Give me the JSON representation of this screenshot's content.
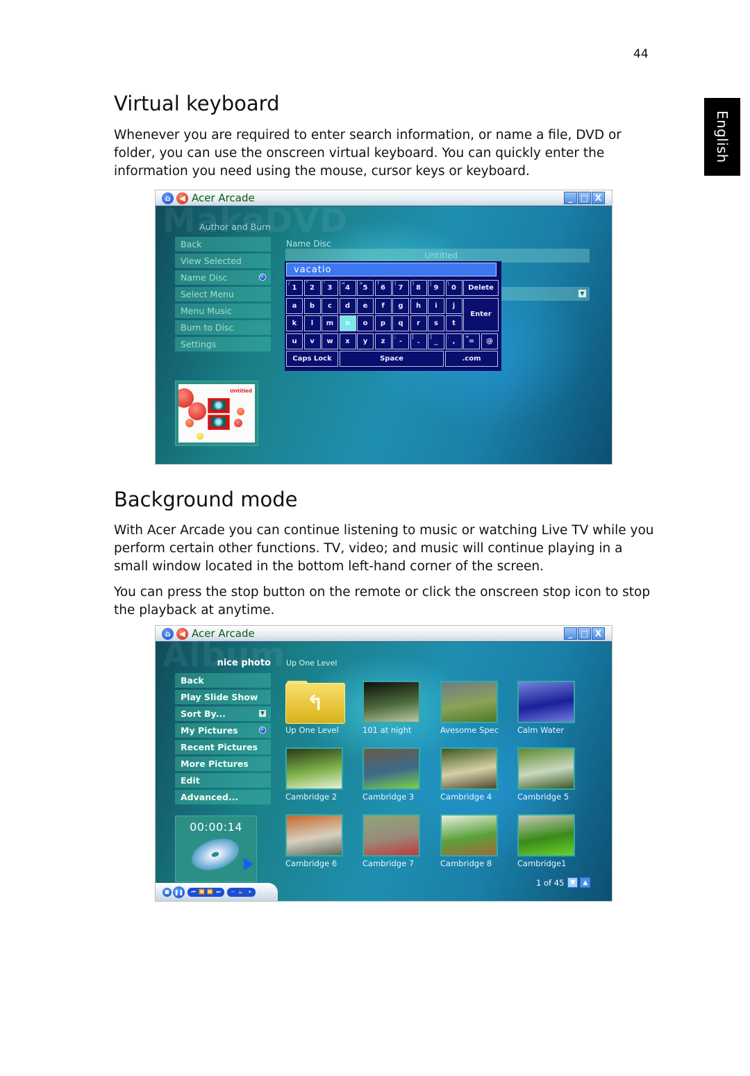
{
  "page": {
    "number": "44",
    "language_tab": "English"
  },
  "sections": [
    {
      "heading": "Virtual keyboard",
      "paragraphs": [
        "Whenever you are required to enter search information, or name a file, DVD or folder, you can use the onscreen virtual keyboard. You can quickly enter the information you need using the mouse, cursor keys or keyboard."
      ]
    },
    {
      "heading": "Background mode",
      "paragraphs": [
        "With Acer Arcade you can continue listening to music or watching Live TV while you perform certain other functions. TV, video; and music will continue playing in a small window located in the bottom left-hand corner of the screen.",
        "You can press the stop button on the remote or click the onscreen stop icon to stop the playback at anytime."
      ]
    }
  ],
  "screenshot1": {
    "app_title": "Acer Arcade",
    "window_controls": {
      "minimize": "_",
      "maximize": "□",
      "close": "X"
    },
    "watermark": "MakeDVD",
    "section_heading": "Author and Burn",
    "menu": [
      {
        "label": "Back"
      },
      {
        "label": "View Selected"
      },
      {
        "label": "Name Disc",
        "selected": true
      },
      {
        "label": "Select Menu"
      },
      {
        "label": "Menu Music"
      },
      {
        "label": "Burn to Disc"
      },
      {
        "label": "Settings"
      }
    ],
    "name_disc_label": "Name Disc",
    "name_field_value": "Untitled",
    "keyboard": {
      "input_value": "vacatio",
      "row1": [
        {
          "key": "1",
          "shift": "/"
        },
        {
          "key": "2",
          "shift": "\""
        },
        {
          "key": "3",
          "shift": "'"
        },
        {
          "key": "4",
          "shift": "<"
        },
        {
          "key": "5",
          "shift": ">"
        },
        {
          "key": "6",
          "shift": "?"
        },
        {
          "key": "7",
          "shift": "("
        },
        {
          "key": "8",
          "shift": ")"
        },
        {
          "key": "9",
          "shift": "|"
        },
        {
          "key": "0",
          "shift": "\\"
        }
      ],
      "row2": [
        "a",
        "b",
        "c",
        "d",
        "e",
        "f",
        "g",
        "h",
        "i",
        "j"
      ],
      "row3": [
        "k",
        "l",
        "m",
        "n",
        "o",
        "p",
        "q",
        "r",
        "s",
        "t"
      ],
      "row4": [
        {
          "key": "u",
          "shift": ""
        },
        {
          "key": "v",
          "shift": ""
        },
        {
          "key": "w",
          "shift": ""
        },
        {
          "key": "x",
          "shift": ""
        },
        {
          "key": "y",
          "shift": ""
        },
        {
          "key": "z",
          "shift": ""
        },
        {
          "key": "-",
          "shift": ";"
        },
        {
          "key": ".",
          "shift": "["
        },
        {
          "key": "_",
          "shift": "]"
        },
        {
          "key": ",",
          "shift": ":"
        },
        {
          "key": "=",
          "shift": "+"
        },
        {
          "key": "@",
          "shift": ""
        }
      ],
      "active_key": "n",
      "delete_label": "Delete",
      "enter_label": "Enter",
      "caps_label": "Caps Lock",
      "space_label": "Space",
      "com_label": ".com"
    },
    "preview_title": "Untitled"
  },
  "screenshot2": {
    "app_title": "Acer Arcade",
    "window_controls": {
      "minimize": "_",
      "maximize": "□",
      "close": "X"
    },
    "watermark": "Album",
    "folder_name": "nice photo",
    "location_label": "Up One Level",
    "menu": [
      {
        "label": "Back"
      },
      {
        "label": "Play Slide Show"
      },
      {
        "label": "Sort By...",
        "dropdown": true
      },
      {
        "label": "My Pictures",
        "selected": true
      },
      {
        "label": "Recent Pictures"
      },
      {
        "label": "More Pictures"
      },
      {
        "label": "Edit"
      },
      {
        "label": "Advanced..."
      }
    ],
    "thumbnails": [
      {
        "caption": "Up One Level",
        "type": "folder"
      },
      {
        "caption": "101 at night",
        "type": "photo",
        "colors": [
          "#0d0f0c",
          "#4d6a3c",
          "#b9c8a0"
        ]
      },
      {
        "caption": "Avesome Spec",
        "type": "photo",
        "colors": [
          "#6c7d86",
          "#8ba25a",
          "#4d7a26"
        ]
      },
      {
        "caption": "Calm Water",
        "type": "photo",
        "colors": [
          "#7484d8",
          "#1b1f9a",
          "#6e7ee0"
        ]
      },
      {
        "caption": "Cambridge 2",
        "type": "photo",
        "colors": [
          "#2a3a16",
          "#7fb24a",
          "#e8f0d8"
        ]
      },
      {
        "caption": "Cambridge 3",
        "type": "photo",
        "colors": [
          "#6a5a48",
          "#3d6b8a",
          "#7cd04a"
        ]
      },
      {
        "caption": "Cambridge 4",
        "type": "photo",
        "colors": [
          "#3c5a1c",
          "#d6cfa8",
          "#4a4a2e"
        ]
      },
      {
        "caption": "Cambridge 5",
        "type": "photo",
        "colors": [
          "#5d8a2c",
          "#c8d8c0",
          "#3a5a24"
        ]
      },
      {
        "caption": "Cambridge 6",
        "type": "photo",
        "colors": [
          "#c4682a",
          "#d8d0c0",
          "#5a6a5a"
        ]
      },
      {
        "caption": "Cambridge 7",
        "type": "photo",
        "colors": [
          "#8aa878",
          "#9a8a7a",
          "#c03a3a"
        ]
      },
      {
        "caption": "Cambridge 8",
        "type": "photo",
        "colors": [
          "#e8f0e0",
          "#5aa03a",
          "#a06a3a"
        ]
      },
      {
        "caption": "Cambridge1",
        "type": "photo",
        "colors": [
          "#c8c8b8",
          "#3a8a1a",
          "#6ad02a"
        ]
      }
    ],
    "pager_text": "1 of 45",
    "player": {
      "time": "00:00:14"
    },
    "controls": {
      "stop": "■",
      "pause": "❚❚",
      "prev": "⏮",
      "rewind": "⏪",
      "forward": "⏩",
      "next": "⏭",
      "vol_down": "−",
      "mute": "🔈",
      "vol_up": "+"
    }
  }
}
